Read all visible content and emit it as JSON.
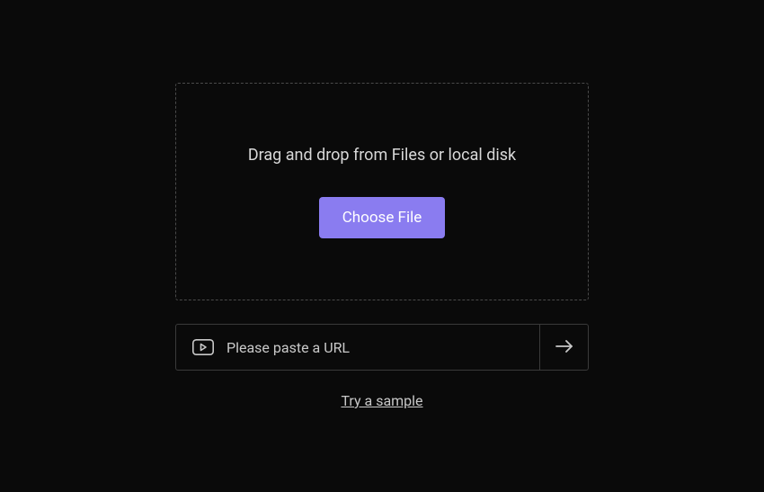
{
  "dropzone": {
    "instruction": "Drag and drop from Files or local disk",
    "button_label": "Choose File"
  },
  "url_input": {
    "placeholder": "Please paste a URL",
    "value": ""
  },
  "sample_link": "Try a sample"
}
